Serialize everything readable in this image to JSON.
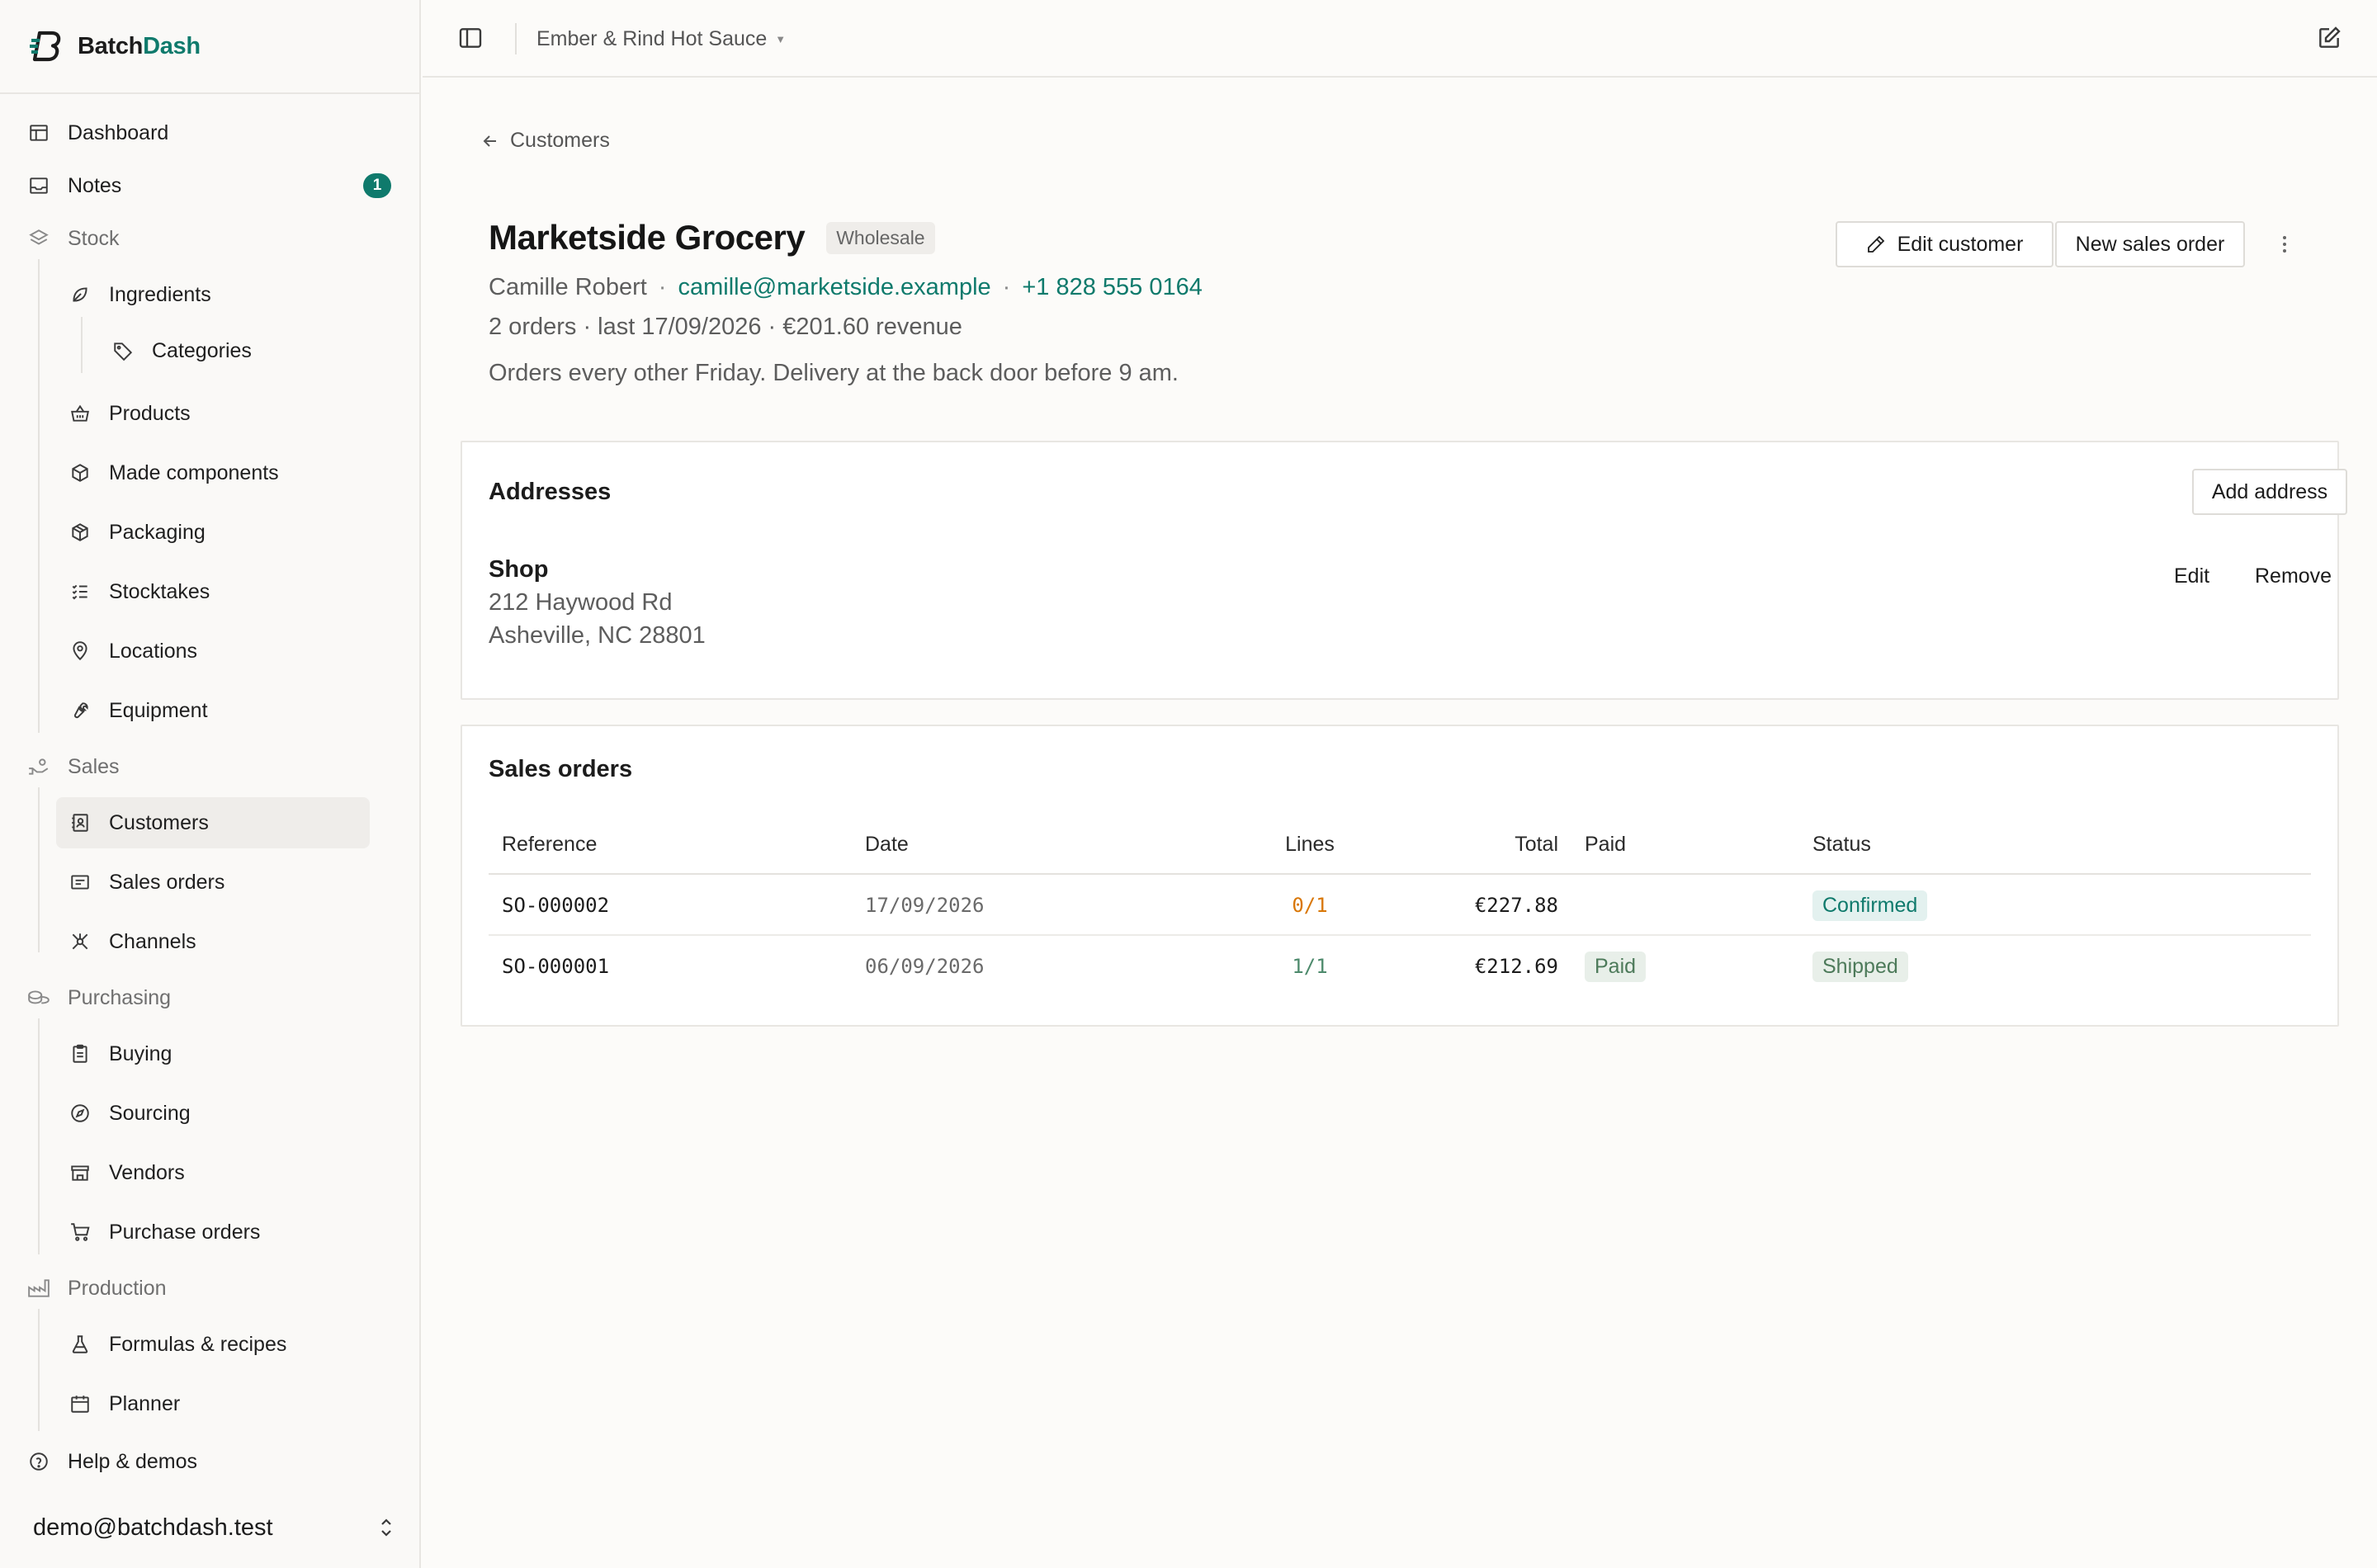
{
  "brand": {
    "part1": "Batch",
    "part2": "Dash"
  },
  "workspace": {
    "name": "Ember & Rind Hot Sauce"
  },
  "sidebar": {
    "dashboard": "Dashboard",
    "notes": "Notes",
    "notes_count": "1",
    "stock": "Stock",
    "ingredients": "Ingredients",
    "categories": "Categories",
    "products": "Products",
    "made_components": "Made components",
    "packaging": "Packaging",
    "stocktakes": "Stocktakes",
    "locations": "Locations",
    "equipment": "Equipment",
    "sales": "Sales",
    "customers": "Customers",
    "sales_orders": "Sales orders",
    "channels": "Channels",
    "purchasing": "Purchasing",
    "buying": "Buying",
    "sourcing": "Sourcing",
    "vendors": "Vendors",
    "purchase_orders": "Purchase orders",
    "production": "Production",
    "formulas": "Formulas & recipes",
    "planner": "Planner",
    "help": "Help & demos",
    "user_email": "demo@batchdash.test"
  },
  "page": {
    "back_label": "Customers",
    "customer_name": "Marketside Grocery",
    "customer_type": "Wholesale",
    "contact_name": "Camille Robert",
    "email": "camille@marketside.example",
    "phone": "+1 828 555 0164",
    "stats": "2 orders · last 17/09/2026 · €201.60 revenue",
    "note": "Orders every other Friday. Delivery at the back door before 9 am.",
    "edit_customer": "Edit customer",
    "new_sales_order": "New sales order"
  },
  "addresses": {
    "title": "Addresses",
    "add_label": "Add address",
    "items": [
      {
        "name": "Shop",
        "line1": "212 Haywood Rd",
        "line2": "Asheville, NC 28801",
        "edit": "Edit",
        "remove": "Remove"
      }
    ]
  },
  "sales_orders": {
    "title": "Sales orders",
    "columns": {
      "reference": "Reference",
      "date": "Date",
      "lines": "Lines",
      "total": "Total",
      "paid": "Paid",
      "status": "Status"
    },
    "rows": [
      {
        "reference": "SO-000002",
        "date": "17/09/2026",
        "lines": "0/1",
        "total": "€227.88",
        "paid": "",
        "status": "Confirmed"
      },
      {
        "reference": "SO-000001",
        "date": "06/09/2026",
        "lines": "1/1",
        "total": "€212.69",
        "paid": "Paid",
        "status": "Shipped"
      }
    ]
  },
  "colors": {
    "accent": "#0f7a6c",
    "warning": "#d97706",
    "success": "#4d7a5a"
  }
}
